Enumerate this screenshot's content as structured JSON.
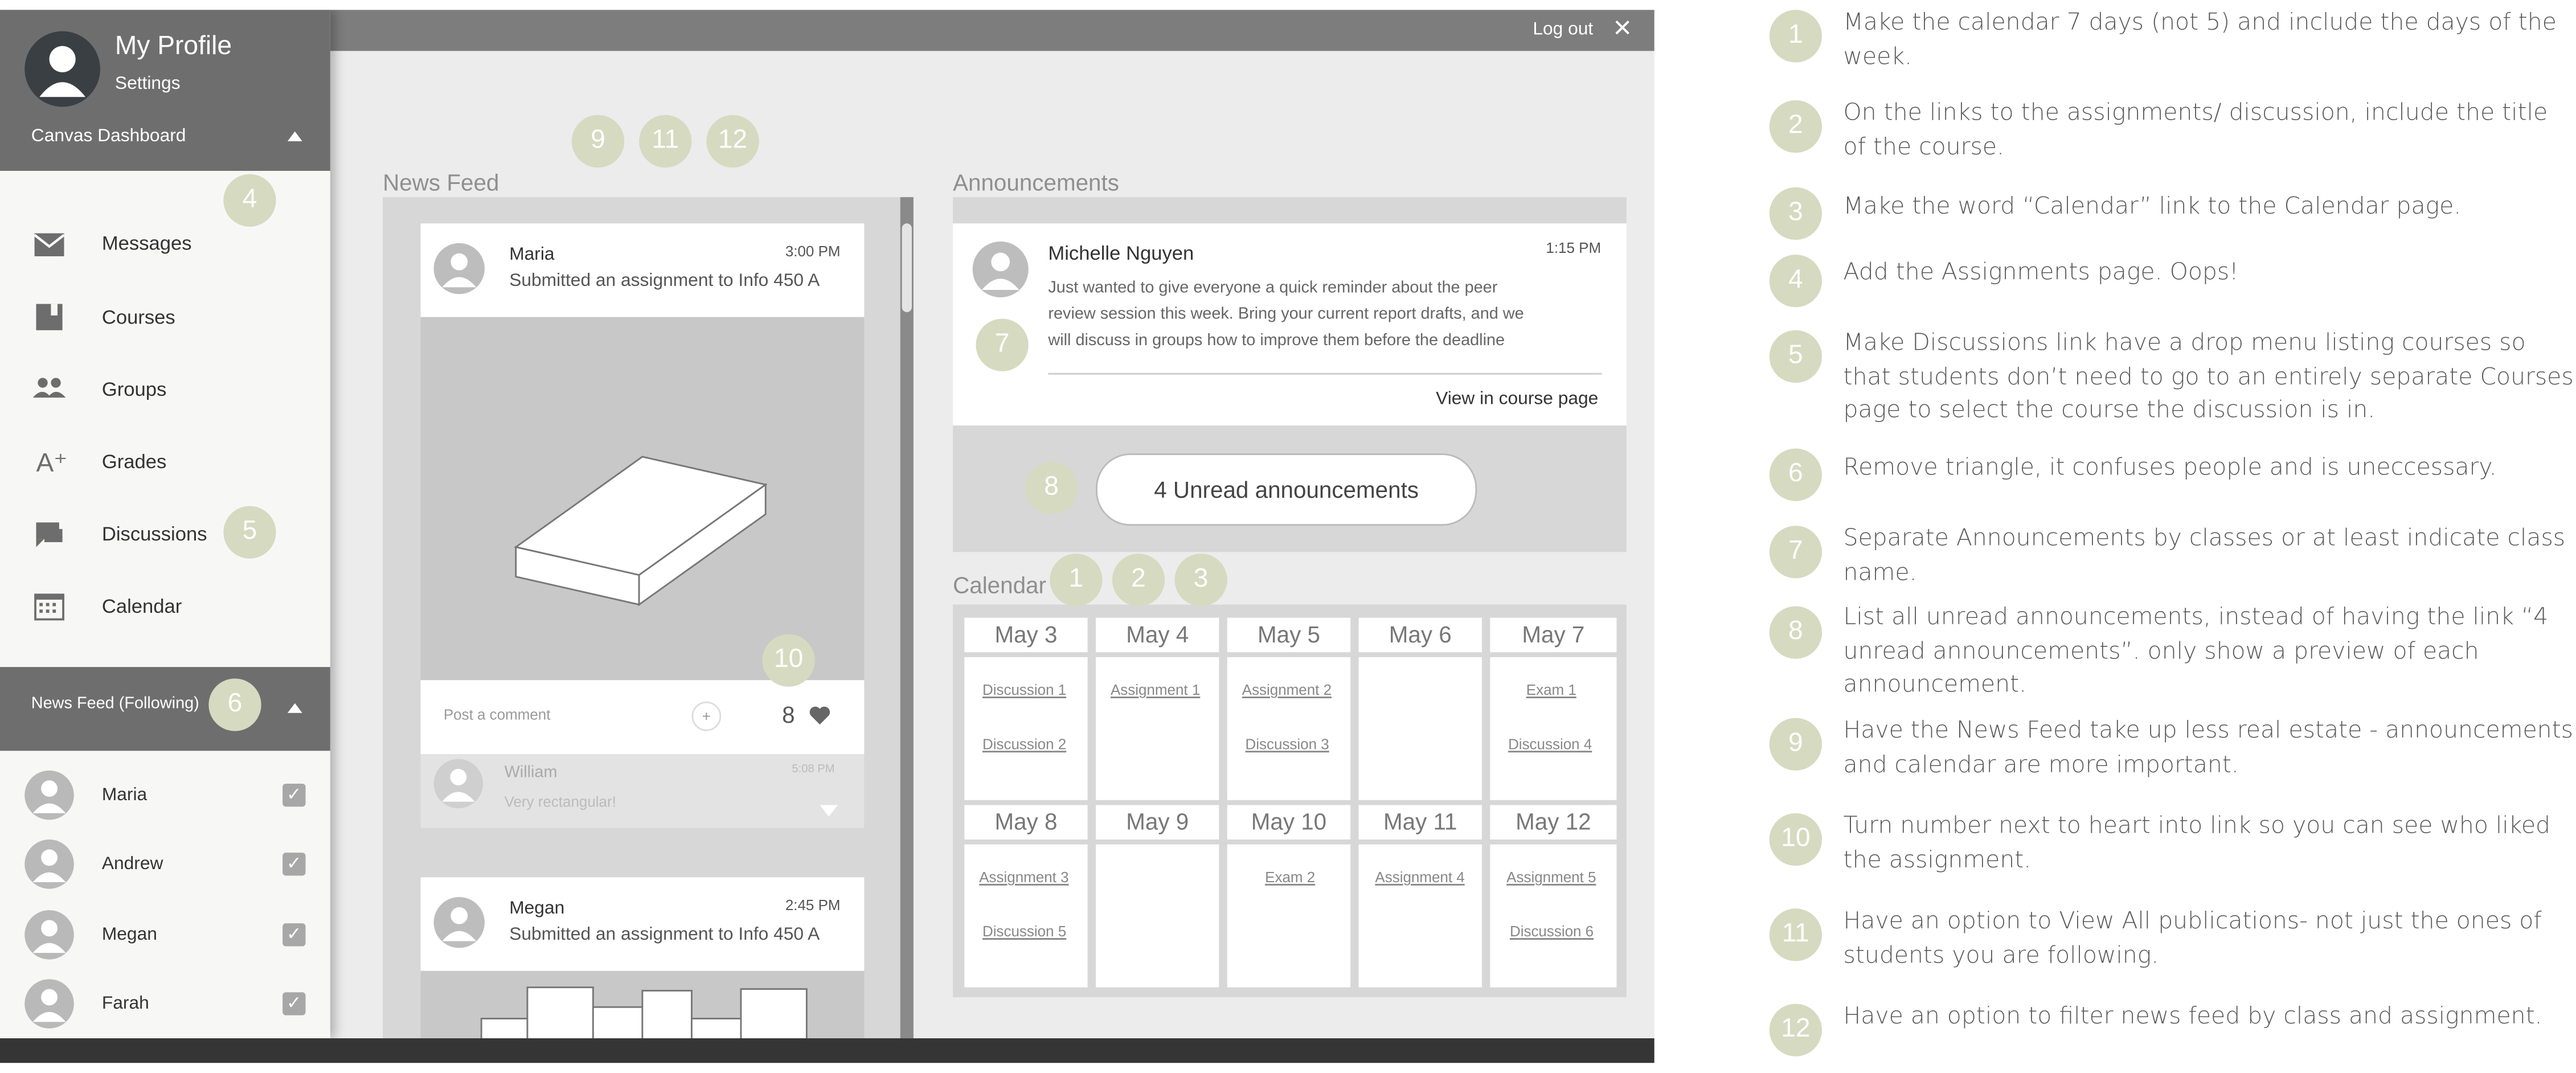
{
  "topbar": {
    "logout_label": "Log out",
    "close_icon": "×"
  },
  "profile": {
    "name": "My Profile",
    "settings": "Settings",
    "dashboard": "Canvas Dashboard"
  },
  "nav": {
    "messages": "Messages",
    "courses": "Courses",
    "groups": "Groups",
    "grades": "Grades",
    "grades_icon": "A⁺",
    "discussions": "Discussions",
    "calendar": "Calendar"
  },
  "following": {
    "header": "News Feed (Following)",
    "people": [
      "Maria",
      "Andrew",
      "Megan",
      "Farah"
    ]
  },
  "feed": {
    "title": "News Feed",
    "post1": {
      "name": "Maria",
      "time": "3:00 PM",
      "text": "Submitted an assignment to Info 450 A",
      "comment_placeholder": "Post a comment",
      "plus": "+",
      "likes": "8"
    },
    "reply": {
      "name": "William",
      "time": "5:08 PM",
      "text": "Very rectangular!"
    },
    "post2": {
      "name": "Megan",
      "time": "2:45 PM",
      "text": "Submitted an assignment to Info 450 A"
    }
  },
  "announcements": {
    "title": "Announcements",
    "author": "Michelle Nguyen",
    "time": "1:15 PM",
    "body": [
      "Just wanted to give everyone a quick reminder about the peer",
      "review session this week. Bring your current report drafts, and we",
      "will discuss in groups how to improve them before the deadline"
    ],
    "view_link": "View in course page",
    "unread_button": "4 Unread announcements"
  },
  "calendar": {
    "title": "Calendar",
    "week1": [
      {
        "day": "May 3",
        "links": [
          "Discussion 1",
          "Discussion 2"
        ]
      },
      {
        "day": "May 4",
        "links": [
          "Assignment 1"
        ]
      },
      {
        "day": "May 5",
        "links": [
          "Assignment 2",
          "Discussion 3"
        ]
      },
      {
        "day": "May 6",
        "links": []
      },
      {
        "day": "May 7",
        "links": [
          "Exam 1",
          "Discussion 4"
        ]
      }
    ],
    "week2": [
      {
        "day": "May 8",
        "links": [
          "Assignment 3",
          "Discussion 5"
        ]
      },
      {
        "day": "May 9",
        "links": []
      },
      {
        "day": "May 10",
        "links": [
          "Exam 2"
        ]
      },
      {
        "day": "May 11",
        "links": [
          "Assignment 4"
        ]
      },
      {
        "day": "May 12",
        "links": [
          "Assignment 5",
          "Discussion 6"
        ]
      }
    ]
  },
  "markers": [
    "9",
    "11",
    "12",
    "4",
    "5",
    "6",
    "10",
    "7",
    "8",
    "1",
    "2",
    "3"
  ],
  "notes": [
    {
      "num": "1",
      "text": "Make the calendar 7 days (not 5)  and include the days of the week."
    },
    {
      "num": "2",
      "text": "On the links to the assignments/ discussion, include the title of the course."
    },
    {
      "num": "3",
      "text": "Make the word “Calendar” link to the Calendar page."
    },
    {
      "num": "4",
      "text": "Add the Assignments page. Oops!"
    },
    {
      "num": "5",
      "text": "Make Discussions link have a drop menu listing courses so that students don’t need to go to an entirely separate Courses page to select the course the discussion is in."
    },
    {
      "num": "6",
      "text": "Remove triangle, it confuses people and is uneccessary."
    },
    {
      "num": "7",
      "text": "Separate Announcements by classes or at least indicate class name."
    },
    {
      "num": "8",
      "text": "List all unread announcements, instead of having the link “4 unread announcements”. only show a preview of each announcement."
    },
    {
      "num": "9",
      "text": "Have the News Feed take up less real estate - announcements and calendar are more important."
    },
    {
      "num": "10",
      "text": "Turn number next to heart into link so you can see who liked the assignment."
    },
    {
      "num": "11",
      "text": "Have an option to View All publications- not just the ones of students you are following."
    },
    {
      "num": "12",
      "text": "Have an option to filter news feed by class and assignment."
    }
  ],
  "colors": {
    "marker": "#d6dac0",
    "dark_bar": "#6e6e6e",
    "topbar": "#7d7d7d",
    "canvas": "#ececec"
  }
}
